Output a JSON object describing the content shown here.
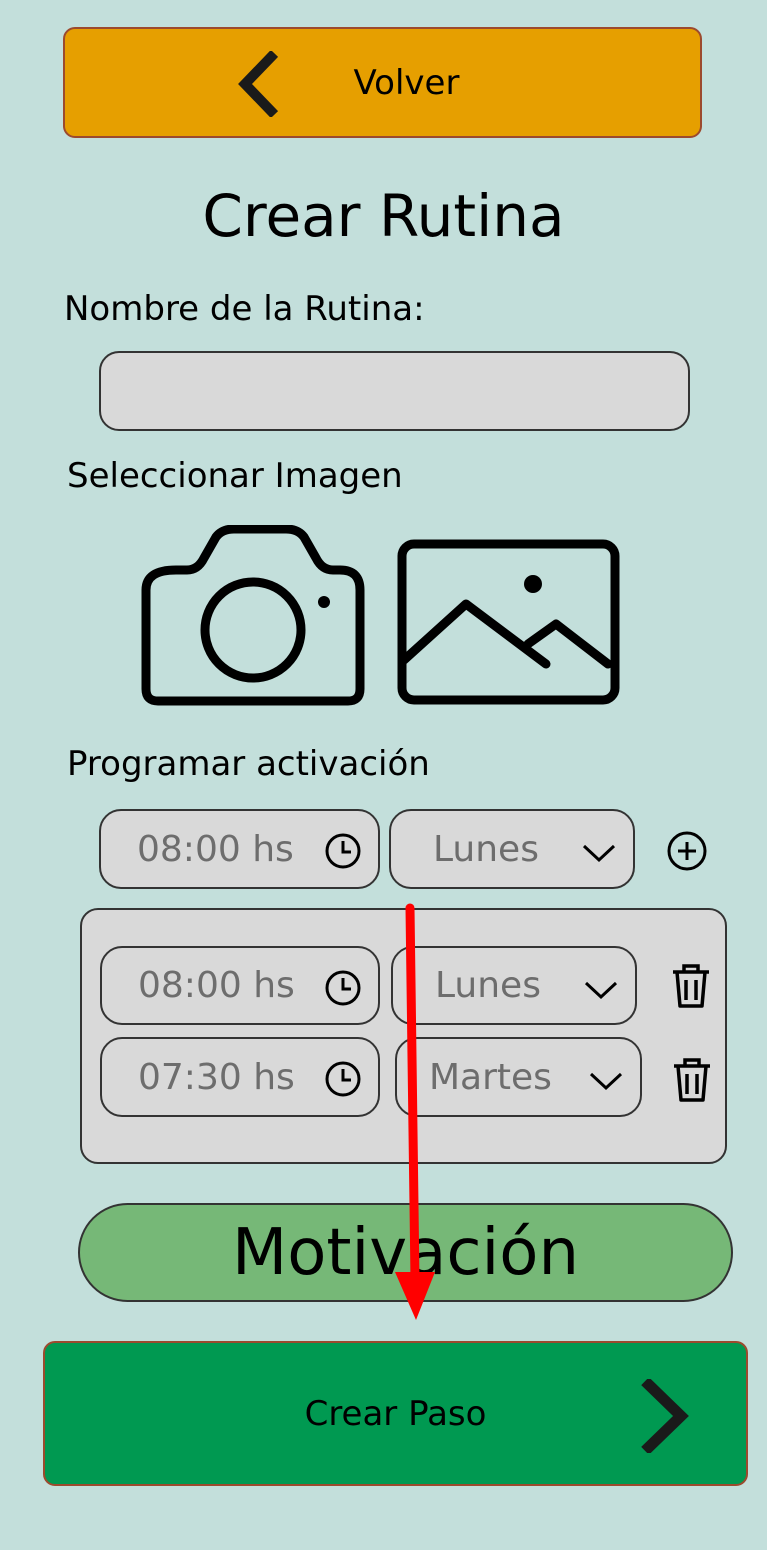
{
  "header": {
    "back_label": "Volver",
    "back_color": "#e69f00"
  },
  "page_title": "Crear Rutina",
  "routine_name": {
    "label": "Nombre de la Rutina:",
    "value": ""
  },
  "image_section": {
    "label": "Seleccionar Imagen",
    "icons": [
      "camera-icon",
      "image-gallery-icon"
    ]
  },
  "schedule": {
    "label": "Programar activación",
    "new_entry": {
      "time": "08:00 hs",
      "day": "Lunes"
    },
    "entries": [
      {
        "time": "08:00 hs",
        "day": "Lunes"
      },
      {
        "time": "07:30 hs",
        "day": "Martes"
      }
    ]
  },
  "motivation_label": "Motivación",
  "create_step": {
    "label": "Crear Paso",
    "color": "#009951"
  },
  "colors": {
    "background": "#c3dfdb",
    "field": "#d9d9d9",
    "motivation": "#76b877",
    "annotation_arrow": "#ff0000"
  }
}
